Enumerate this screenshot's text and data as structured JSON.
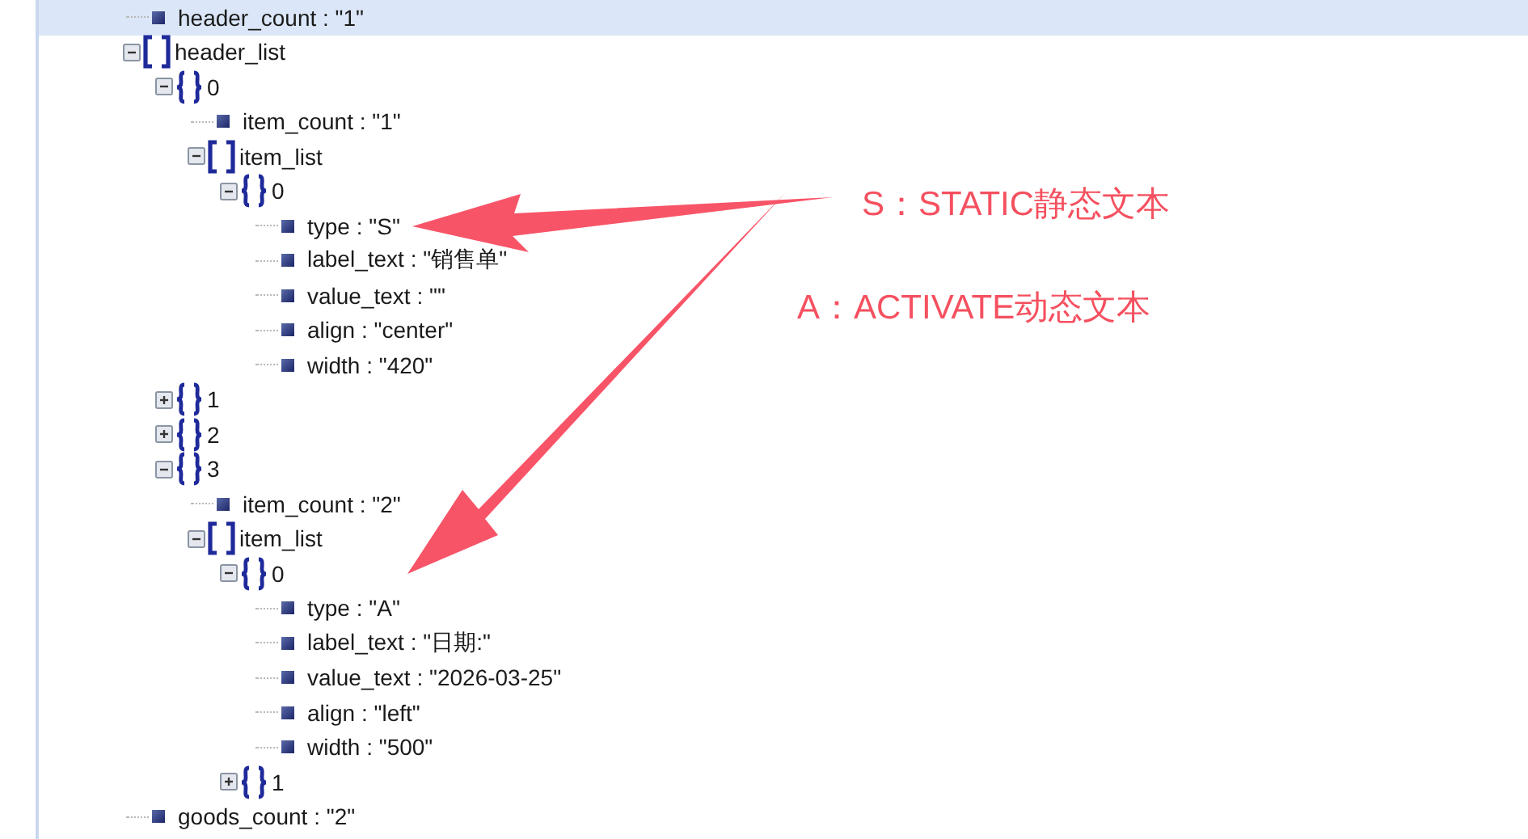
{
  "tree": [
    {
      "kind": "value",
      "text": "header_count : \"1\"",
      "selected": true
    },
    {
      "kind": "array",
      "text": "header_list",
      "expanded": true,
      "selected": false,
      "children": [
        {
          "kind": "object",
          "text": "0",
          "expanded": true,
          "selected": false,
          "children": [
            {
              "kind": "value",
              "text": "item_count : \"1\"",
              "selected": false
            },
            {
              "kind": "array",
              "text": "item_list",
              "expanded": true,
              "selected": false,
              "children": [
                {
                  "kind": "object",
                  "text": "0",
                  "expanded": true,
                  "selected": false,
                  "children": [
                    {
                      "kind": "value",
                      "text": "type : \"S\"",
                      "selected": false
                    },
                    {
                      "kind": "value",
                      "text": "label_text : \"销售单\"",
                      "selected": false
                    },
                    {
                      "kind": "value",
                      "text": "value_text : \"\"",
                      "selected": false
                    },
                    {
                      "kind": "value",
                      "text": "align : \"center\"",
                      "selected": false
                    },
                    {
                      "kind": "value",
                      "text": "width : \"420\"",
                      "selected": false
                    }
                  ]
                }
              ]
            }
          ]
        },
        {
          "kind": "object",
          "text": "1",
          "expanded": false,
          "selected": false
        },
        {
          "kind": "object",
          "text": "2",
          "expanded": false,
          "selected": false
        },
        {
          "kind": "object",
          "text": "3",
          "expanded": true,
          "selected": false,
          "children": [
            {
              "kind": "value",
              "text": "item_count : \"2\"",
              "selected": false
            },
            {
              "kind": "array",
              "text": "item_list",
              "expanded": true,
              "selected": false,
              "children": [
                {
                  "kind": "object",
                  "text": "0",
                  "expanded": true,
                  "selected": false,
                  "children": [
                    {
                      "kind": "value",
                      "text": "type : \"A\"",
                      "selected": false
                    },
                    {
                      "kind": "value",
                      "text": "label_text : \"日期:\"",
                      "selected": false
                    },
                    {
                      "kind": "value",
                      "text": "value_text : \"2026-03-25\"",
                      "selected": false
                    },
                    {
                      "kind": "value",
                      "text": "align : \"left\"",
                      "selected": false
                    },
                    {
                      "kind": "value",
                      "text": "width : \"500\"",
                      "selected": false
                    }
                  ]
                },
                {
                  "kind": "object",
                  "text": "1",
                  "expanded": false,
                  "selected": false
                }
              ]
            }
          ]
        }
      ]
    },
    {
      "kind": "value",
      "text": "goods_count : \"2\"",
      "selected": false
    }
  ],
  "annotations": [
    {
      "text": "S：STATIC静态文本"
    },
    {
      "text": "A：ACTIVATE动态文本"
    }
  ]
}
